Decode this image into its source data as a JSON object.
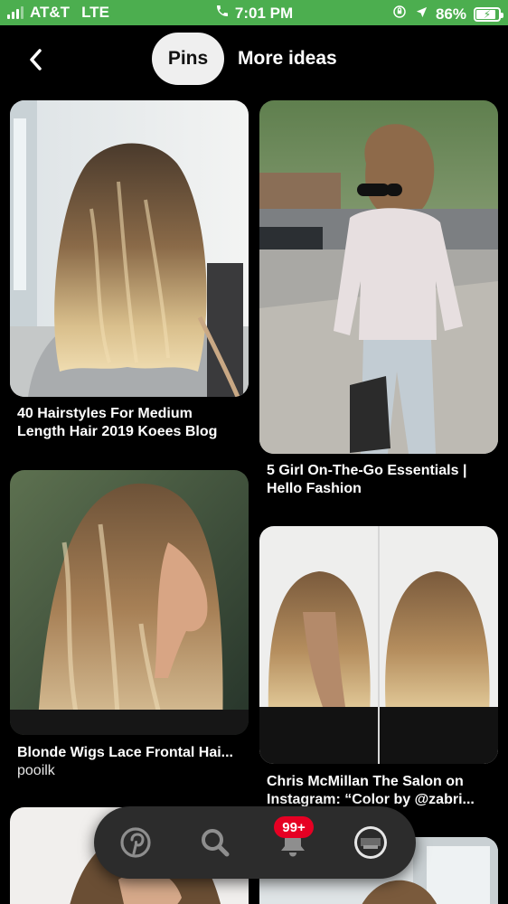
{
  "status_bar": {
    "carrier": "AT&T",
    "network": "LTE",
    "time": "7:01 PM",
    "battery_percent": "86%",
    "battery_level": 0.86,
    "color": "#4cae4f"
  },
  "header": {
    "tabs": [
      {
        "label": "Pins",
        "selected": true
      },
      {
        "label": "More ideas",
        "selected": false
      }
    ]
  },
  "pins": [
    {
      "title": "40 Hairstyles For Medium Length Hair 2019 Koees Blog",
      "subtitle": ""
    },
    {
      "title": "5 Girl On-The-Go Essentials | Hello Fashion",
      "subtitle": ""
    },
    {
      "title": "Blonde Wigs Lace Frontal Hai...",
      "subtitle": "pooilk"
    },
    {
      "title": "Chris McMillan The Salon on Instagram: “Color by @zabri...",
      "subtitle": ""
    }
  ],
  "bottom_nav": {
    "items": [
      "pinterest-home-icon",
      "search-icon",
      "notifications-bell-icon",
      "profile-avatar"
    ],
    "notification_badge": "99+",
    "accent": "#e60023"
  }
}
